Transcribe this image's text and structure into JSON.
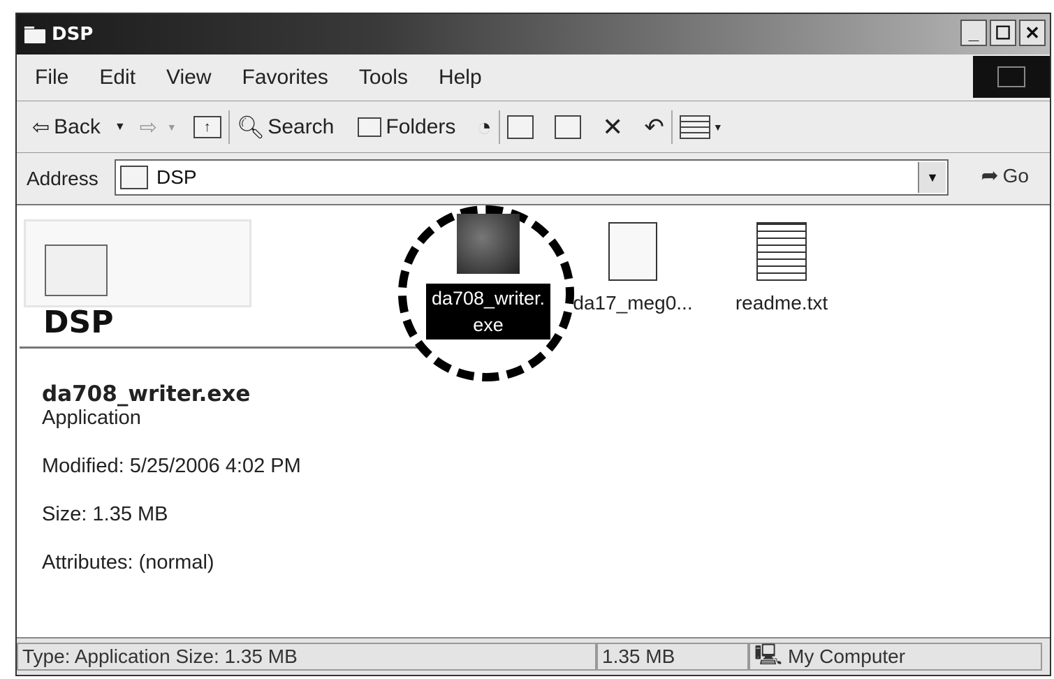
{
  "window": {
    "title": "DSP"
  },
  "menu": [
    "File",
    "Edit",
    "View",
    "Favorites",
    "Tools",
    "Help"
  ],
  "toolbar": {
    "back_label": "Back",
    "search_label": "Search",
    "folders_label": "Folders"
  },
  "address": {
    "label": "Address",
    "value": "DSP",
    "go_label": "Go"
  },
  "folder_title": "DSP",
  "details": {
    "name": "da708_writer.exe",
    "type": "Application",
    "modified": "Modified: 5/25/2006 4:02 PM",
    "size": "Size: 1.35 MB",
    "attributes": "Attributes: (normal)"
  },
  "files": [
    {
      "name_line1": "da708_writer.",
      "name_line2": "exe",
      "selected": true
    },
    {
      "name": "da17_meg0..."
    },
    {
      "name": "readme.txt"
    }
  ],
  "status": {
    "type_size": "Type: Application Size: 1.35 MB",
    "size": "1.35 MB",
    "location": "My Computer"
  }
}
